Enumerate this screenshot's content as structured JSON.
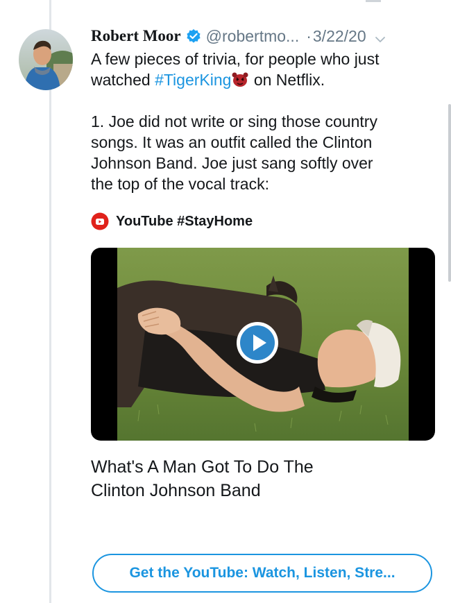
{
  "tweet": {
    "author_name": "Robert Moor",
    "handle": "@robertmo...",
    "separator": "·",
    "date": "3/22/20",
    "line1": "A few pieces of trivia, for people who just",
    "line2_prefix": "watched ",
    "hashtag": "#TigerKing",
    "line2_suffix": " on Netflix.",
    "para2_lines": [
      "1. Joe did not write or sing those country",
      "songs. It was an outfit called the Clinton",
      "Johnson Band. Joe just sang softly over",
      "the top of the vocal track:"
    ],
    "source_label": "YouTube #StayHome",
    "link_title_lines": [
      "What's A Man Got To Do The",
      "Clinton Johnson Band"
    ],
    "cta_label": "Get the YouTube: Watch, Listen, Stre..."
  },
  "icons": {
    "verified": "verified-badge-icon",
    "chevron": "chevron-down-icon",
    "tiger_emoji": "tiger-emoji-icon",
    "source": "youtube-icon",
    "play": "play-icon"
  },
  "colors": {
    "link": "#1b95e0",
    "muted": "#657786",
    "text": "#14171a",
    "youtube_red": "#e0221b"
  }
}
